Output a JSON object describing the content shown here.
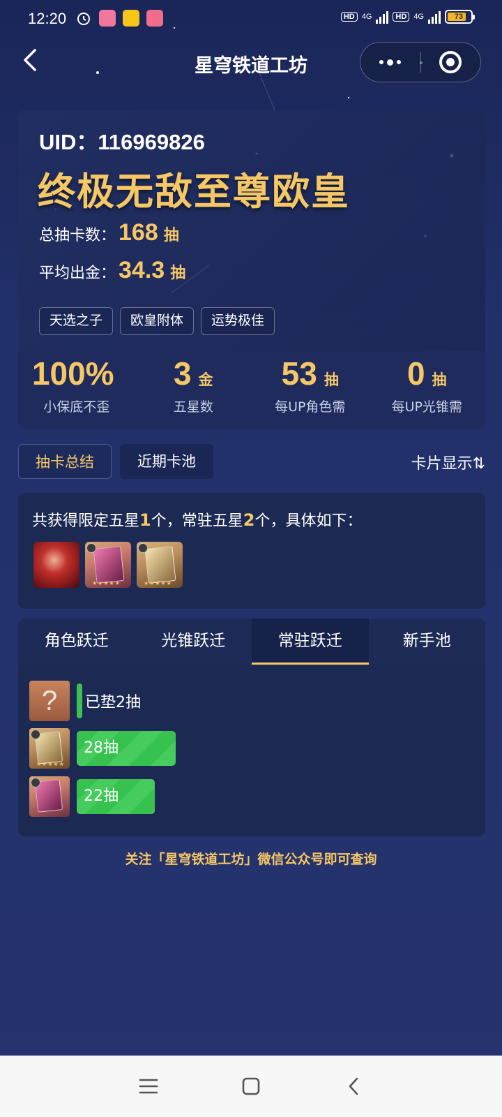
{
  "status_bar": {
    "time": "12:20",
    "hd1": "HD",
    "net1": "4G",
    "hd2": "HD",
    "net2": "4G",
    "battery": "73"
  },
  "header": {
    "title": "星穹铁道工坊"
  },
  "summary": {
    "uid": "UID：116969826",
    "rank_title": "终极无敌至尊欧皇",
    "total_pulls_label": "总抽卡数：",
    "total_pulls_value": "168",
    "total_pulls_unit": "抽",
    "avg_gold_label": "平均出金：",
    "avg_gold_value": "34.3",
    "avg_gold_unit": "抽",
    "tags": [
      "天选之子",
      "欧皇附体",
      "运势极佳"
    ],
    "metrics": [
      {
        "value": "100%",
        "unit": "",
        "label": "小保底不歪"
      },
      {
        "value": "3",
        "unit": "金",
        "label": "五星数"
      },
      {
        "value": "53",
        "unit": "抽",
        "label": "每UP角色需"
      },
      {
        "value": "0",
        "unit": "抽",
        "label": "每UP光锥需"
      }
    ]
  },
  "view_tabs": {
    "summary": "抽卡总结",
    "recent": "近期卡池",
    "card_display": "卡片显示⇅"
  },
  "obtained": {
    "prefix": "共获得限定五星",
    "limited_count": "1",
    "mid": "个，常驻五星",
    "standard_count": "2",
    "suffix": "个，具体如下："
  },
  "warp_tabs": [
    "角色跃迁",
    "光锥跃迁",
    "常驻跃迁",
    "新手池"
  ],
  "warp_active_index": 2,
  "pulls": [
    {
      "label": "已垫2抽",
      "pulls": 2
    },
    {
      "label": "28抽",
      "pulls": 28
    },
    {
      "label": "22抽",
      "pulls": 22
    }
  ],
  "footer_note": "关注「星穹铁道工坊」微信公众号即可查询",
  "colors": {
    "accent_gold": "#f6c765",
    "bar_green": "#3ac152",
    "navbar_bg": "#f7f7f7"
  },
  "icons": {
    "back": "chevron-left-icon",
    "more": "more-dots-icon",
    "close": "target-close-icon",
    "nav_menu": "menu-icon",
    "nav_home": "square-home-icon",
    "nav_back": "chevron-left-icon"
  }
}
